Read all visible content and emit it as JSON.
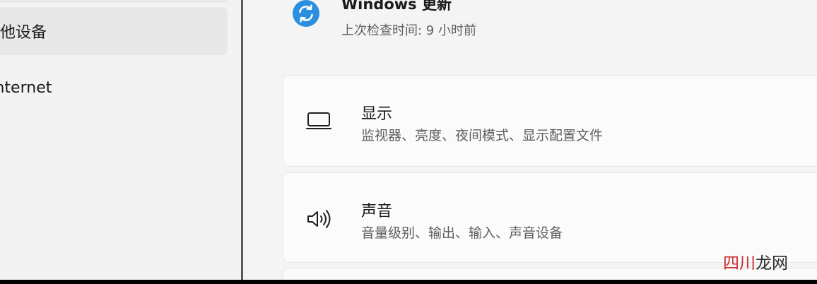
{
  "sidebar": {
    "items": [
      {
        "label": "其他设备",
        "selected": true
      },
      {
        "label": "Internet",
        "selected": false
      }
    ]
  },
  "update": {
    "title": "Windows 更新",
    "subtitle": "上次检查时间: 9 小时前",
    "icon": "sync-icon",
    "accent": "#2b8fe0"
  },
  "cards": [
    {
      "title": "显示",
      "description": "监视器、亮度、夜间模式、显示配置文件",
      "icon": "monitor-icon"
    },
    {
      "title": "声音",
      "description": "音量级别、输出、输入、声音设备",
      "icon": "speaker-icon"
    }
  ],
  "watermark": {
    "part1": "四川",
    "part2": "龙网"
  }
}
